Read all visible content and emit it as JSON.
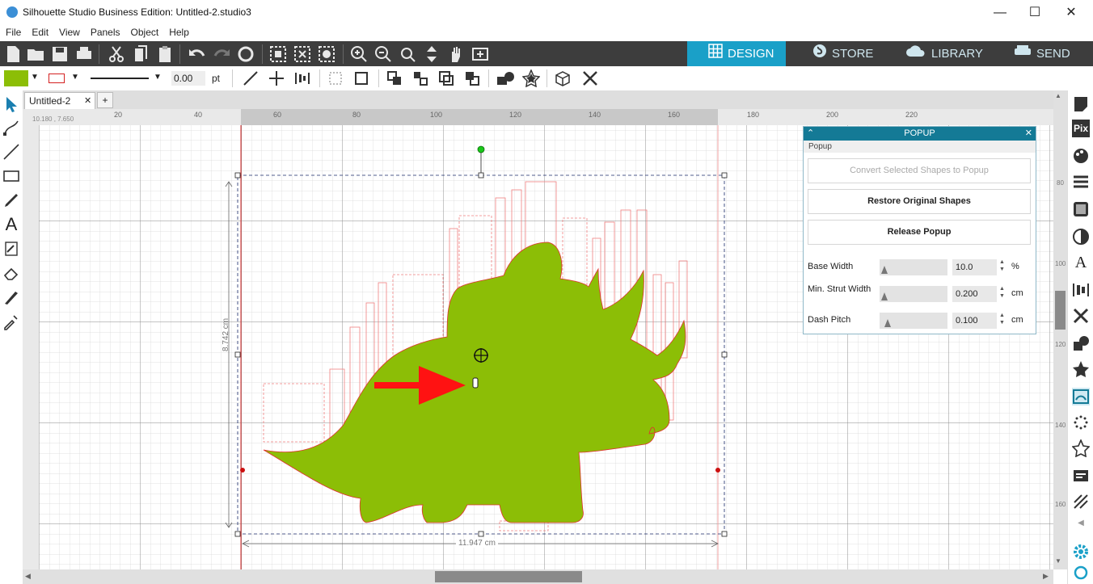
{
  "window": {
    "title": "Silhouette Studio Business Edition: Untitled-2.studio3"
  },
  "menu": [
    "File",
    "Edit",
    "View",
    "Panels",
    "Object",
    "Help"
  ],
  "nav_tabs": [
    {
      "label": "DESIGN",
      "active": true
    },
    {
      "label": "STORE",
      "active": false
    },
    {
      "label": "LIBRARY",
      "active": false
    },
    {
      "label": "SEND",
      "active": false
    }
  ],
  "toolbar2": {
    "fill_color": "#8cbe06",
    "line_color": "#d42020",
    "line_width": "0.00",
    "line_unit": "pt"
  },
  "doc_tab": {
    "label": "Untitled-2",
    "add": "+"
  },
  "ruler": {
    "coords": "10.180 , 7.650",
    "h_ticks": [
      "20",
      "40",
      "60",
      "80",
      "100",
      "120",
      "140",
      "160",
      "180",
      "200",
      "220"
    ],
    "v_ticks": [
      "80",
      "100",
      "120",
      "140",
      "160"
    ]
  },
  "canvas": {
    "height_dim": "8.742 cm",
    "width_dim": "11.947 cm",
    "shape_color": "#8cbe06",
    "accent_color": "#1aa0c8"
  },
  "popup_panel": {
    "title": "POPUP",
    "section": "Popup",
    "buttons": {
      "convert": "Convert Selected Shapes to Popup",
      "restore": "Restore Original Shapes",
      "release": "Release Popup"
    },
    "fields": [
      {
        "label": "Base Width",
        "value": "10.0",
        "unit": "%"
      },
      {
        "label": "Min. Strut Width",
        "value": "0.200",
        "unit": "cm"
      },
      {
        "label": "Dash Pitch",
        "value": "0.100",
        "unit": "cm"
      }
    ]
  }
}
